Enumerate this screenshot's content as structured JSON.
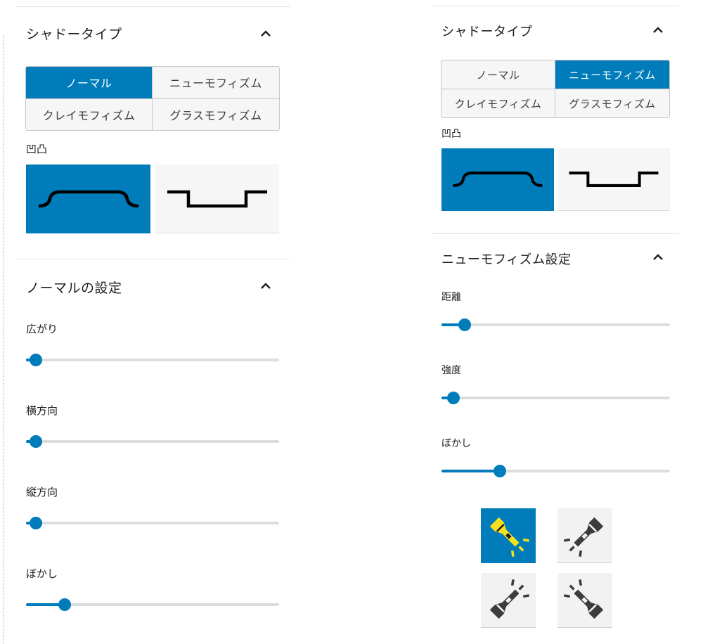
{
  "colors": {
    "accent": "#007cba",
    "inactive_bg": "#f6f6f6",
    "track": "#dddddd",
    "flash_yellow": "#f5e11e"
  },
  "left": {
    "shadow_type": {
      "title": "シャドータイプ",
      "options": [
        "ノーマル",
        "ニューモフィズム",
        "クレイモフィズム",
        "グラスモフィズム"
      ],
      "selected": "ノーマル",
      "profile_label": "凹凸",
      "profile_options": [
        "convex-profile-icon",
        "concave-profile-icon"
      ],
      "profile_selected": "convex-profile-icon"
    },
    "settings": {
      "title": "ノーマルの設定",
      "sliders": [
        {
          "label": "広がり",
          "fraction": 0.04
        },
        {
          "label": "横方向",
          "fraction": 0.04
        },
        {
          "label": "縦方向",
          "fraction": 0.04
        },
        {
          "label": "ぼかし",
          "fraction": 0.153
        }
      ]
    }
  },
  "right": {
    "shadow_type": {
      "title": "シャドータイプ",
      "options": [
        "ノーマル",
        "ニューモフィズム",
        "クレイモフィズム",
        "グラスモフィズム"
      ],
      "selected": "ニューモフィズム",
      "profile_label": "凹凸",
      "profile_options": [
        "convex-profile-icon",
        "concave-profile-icon"
      ],
      "profile_selected": "convex-profile-icon"
    },
    "settings": {
      "title": "ニューモフィズム設定",
      "sliders": [
        {
          "label": "距離",
          "fraction": 0.102
        },
        {
          "label": "強度",
          "fraction": 0.052
        },
        {
          "label": "ぼかし",
          "fraction": 0.255
        }
      ],
      "light_directions": [
        "top-left",
        "top-right",
        "bottom-left",
        "bottom-right"
      ],
      "light_selected": "top-left"
    }
  }
}
